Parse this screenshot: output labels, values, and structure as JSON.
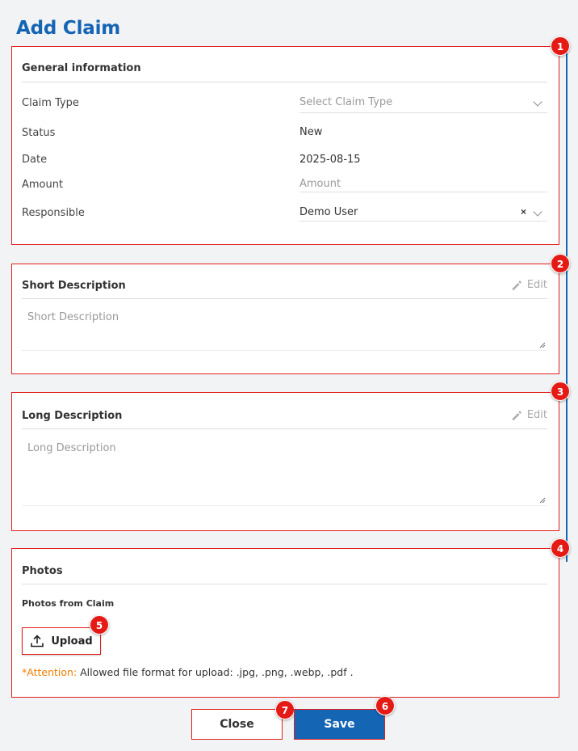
{
  "page": {
    "title": "Add Claim"
  },
  "general": {
    "badge": "1",
    "title": "General information",
    "claim_type": {
      "label": "Claim Type",
      "placeholder": "Select Claim Type"
    },
    "status": {
      "label": "Status",
      "value": "New"
    },
    "date": {
      "label": "Date",
      "value": "2025-08-15"
    },
    "amount": {
      "label": "Amount",
      "placeholder": "Amount"
    },
    "responsible": {
      "label": "Responsible",
      "value": "Demo User",
      "clear": "×"
    }
  },
  "short_description": {
    "badge": "2",
    "title": "Short Description",
    "edit_label": "Edit",
    "placeholder": "Short Description"
  },
  "long_description": {
    "badge": "3",
    "title": "Long Description",
    "edit_label": "Edit",
    "placeholder": "Long Description"
  },
  "photos": {
    "badge": "4",
    "title": "Photos",
    "subtitle": "Photos from Claim",
    "upload_badge": "5",
    "upload_label": "Upload",
    "attention_label": "*Attention:",
    "attention_text": " Allowed file format for upload: .jpg, .png, .webp, .pdf ."
  },
  "footer": {
    "close_label": "Close",
    "close_badge": "7",
    "save_label": "Save",
    "save_badge": "6"
  },
  "colors": {
    "accent": "#1565b5",
    "highlight": "#e2201d",
    "warning": "#f07c00"
  },
  "icons": {
    "edit": "pencil-icon",
    "upload": "upload-icon",
    "dropdown": "chevron-down-icon",
    "clear": "clear-icon"
  }
}
